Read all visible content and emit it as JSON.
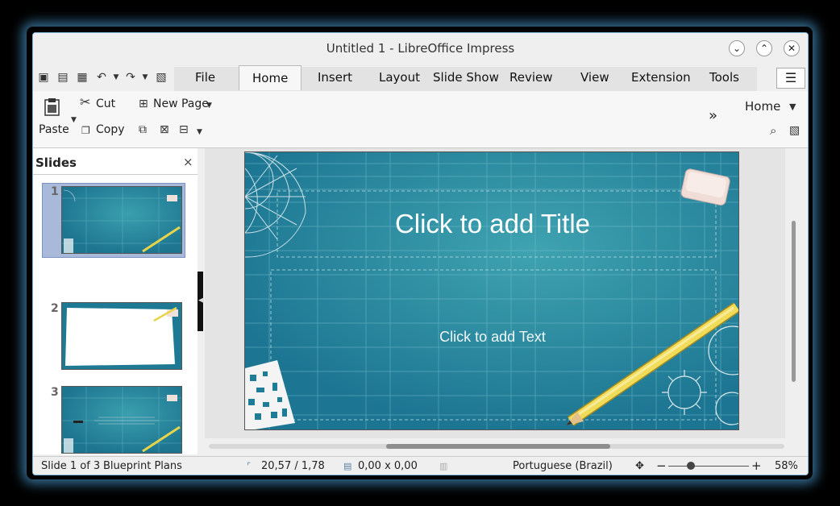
{
  "window": {
    "title": "Untitled 1 - LibreOffice Impress",
    "controls": [
      "⌄",
      "⌃",
      "✕"
    ]
  },
  "menu": {
    "tabs": [
      {
        "label": "File"
      },
      {
        "label": "Home"
      },
      {
        "label": "Insert"
      },
      {
        "label": "Layout"
      },
      {
        "label": "Slide Show"
      },
      {
        "label": "Review"
      },
      {
        "label": "View"
      },
      {
        "label": "Extension"
      },
      {
        "label": "Tools"
      }
    ],
    "active_tab": "Home",
    "hamburger": "☰"
  },
  "ribbon": {
    "paste": "Paste",
    "cut": "Cut",
    "copy": "Copy",
    "new_page": "New Page",
    "more": "»",
    "context": "Home"
  },
  "slides_panel": {
    "title": "Slides",
    "close": "×",
    "thumbnails": [
      {
        "number": "1",
        "selected": true
      },
      {
        "number": "2",
        "selected": false
      },
      {
        "number": "3",
        "selected": false
      }
    ]
  },
  "slide": {
    "title_placeholder": "Click to add Title",
    "text_placeholder": "Click to add Text",
    "background_color": "#1f7c96"
  },
  "status": {
    "slide_info": "Slide 1 of 3",
    "master": "Blueprint Plans",
    "position": "20,57 / 1,78",
    "size": "0,00 x 0,00",
    "language": "Portuguese (Brazil)",
    "zoom_minus": "−",
    "zoom_plus": "+",
    "zoom": "58%"
  }
}
